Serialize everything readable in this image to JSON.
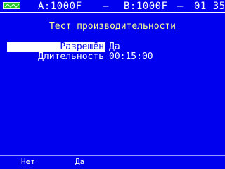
{
  "status": {
    "battery_icon": "battery-wave-icon",
    "battery_color": "#22c52a",
    "channel_a": "A:1000F",
    "dash": "–",
    "channel_b": "B:1000F",
    "channel_num": "01 35"
  },
  "screen": {
    "title": "Тест производительности",
    "params": [
      {
        "label": "Разрешён",
        "value": "Да",
        "selected": true
      },
      {
        "label": "Длительность",
        "value": "00:15:00",
        "selected": false
      }
    ]
  },
  "softkeys": [
    {
      "label": "Нет"
    },
    {
      "label": "Да"
    }
  ],
  "colors": {
    "background": "#0000ee",
    "title": "#ffff99",
    "selection": "#ffffff"
  }
}
